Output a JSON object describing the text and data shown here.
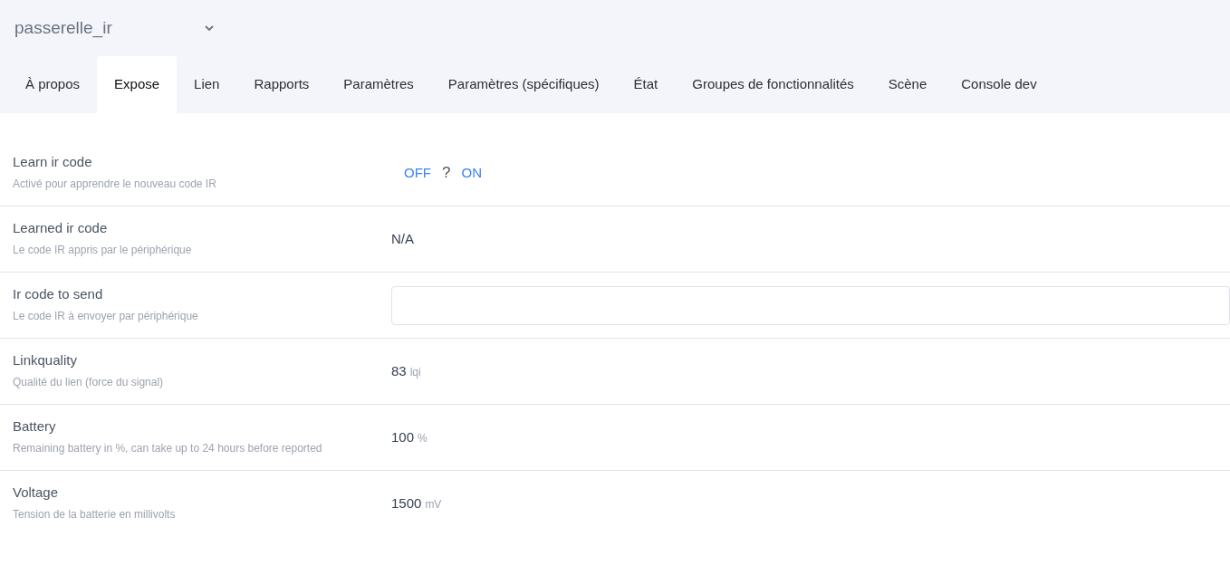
{
  "device_select": {
    "value": "passerelle_ir"
  },
  "tabs": [
    {
      "label": "À propos",
      "selected": false
    },
    {
      "label": "Expose",
      "selected": true
    },
    {
      "label": "Lien",
      "selected": false
    },
    {
      "label": "Rapports",
      "selected": false
    },
    {
      "label": "Paramètres",
      "selected": false
    },
    {
      "label": "Paramètres (spécifiques)",
      "selected": false
    },
    {
      "label": "État",
      "selected": false
    },
    {
      "label": "Groupes de fonctionnalités",
      "selected": false
    },
    {
      "label": "Scène",
      "selected": false
    },
    {
      "label": "Console dev",
      "selected": false
    }
  ],
  "features": [
    {
      "kind": "toggle",
      "name": "Learn ir code",
      "description": "Activé pour apprendre le nouveau code IR",
      "off_label": "OFF",
      "state": "?",
      "on_label": "ON"
    },
    {
      "kind": "text",
      "name": "Learned ir code",
      "description": "Le code IR appris par le périphérique",
      "value": "N/A"
    },
    {
      "kind": "input",
      "name": "Ir code to send",
      "description": "Le code IR à envoyer par périphérique"
    },
    {
      "kind": "numeric",
      "name": "Linkquality",
      "description": "Qualité du lien (force du signal)",
      "value": "83",
      "unit": "lqi"
    },
    {
      "kind": "numeric",
      "name": "Battery",
      "description": "Remaining battery in %, can take up to 24 hours before reported",
      "value": "100",
      "unit": "%"
    },
    {
      "kind": "numeric",
      "name": "Voltage",
      "description": "Tension de la batterie en millivolts",
      "value": "1500",
      "unit": "mV"
    }
  ]
}
